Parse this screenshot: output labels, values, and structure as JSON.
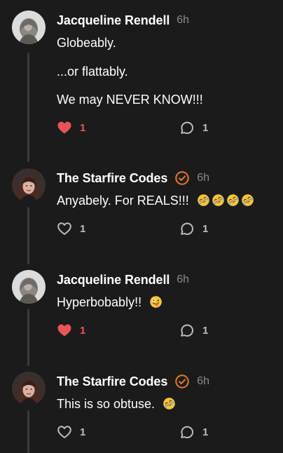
{
  "colors": {
    "background": "#1b1b1c",
    "thread_line": "#3a3a3b",
    "heart_active": "#e8545a",
    "verified_badge": "#e8762b",
    "muted_text": "#8b8b8d"
  },
  "comments": [
    {
      "author": "Jacqueline Rendell",
      "time": "6h",
      "verified": false,
      "paragraphs": [
        "Globeably.",
        "...or flattably.",
        "We may NEVER KNOW!!!"
      ],
      "likes": "1",
      "liked": true,
      "replies": "1"
    },
    {
      "author": "The Starfire Codes",
      "time": "6h",
      "verified": true,
      "paragraphs": [
        "Anyabely. For REALS!!!"
      ],
      "emoji": [
        "rofl",
        "rofl",
        "rofl",
        "rofl"
      ],
      "likes": "1",
      "liked": false,
      "replies": "1"
    },
    {
      "author": "Jacqueline Rendell",
      "time": "6h",
      "verified": false,
      "paragraphs": [
        "Hyperbobably!!"
      ],
      "emoji": [
        "zany-face"
      ],
      "likes": "1",
      "liked": true,
      "replies": "1"
    },
    {
      "author": "The Starfire Codes",
      "time": "6h",
      "verified": true,
      "paragraphs": [
        "This is so obtuse."
      ],
      "emoji": [
        "rofl"
      ],
      "likes": "1",
      "liked": false,
      "replies": "1"
    }
  ]
}
